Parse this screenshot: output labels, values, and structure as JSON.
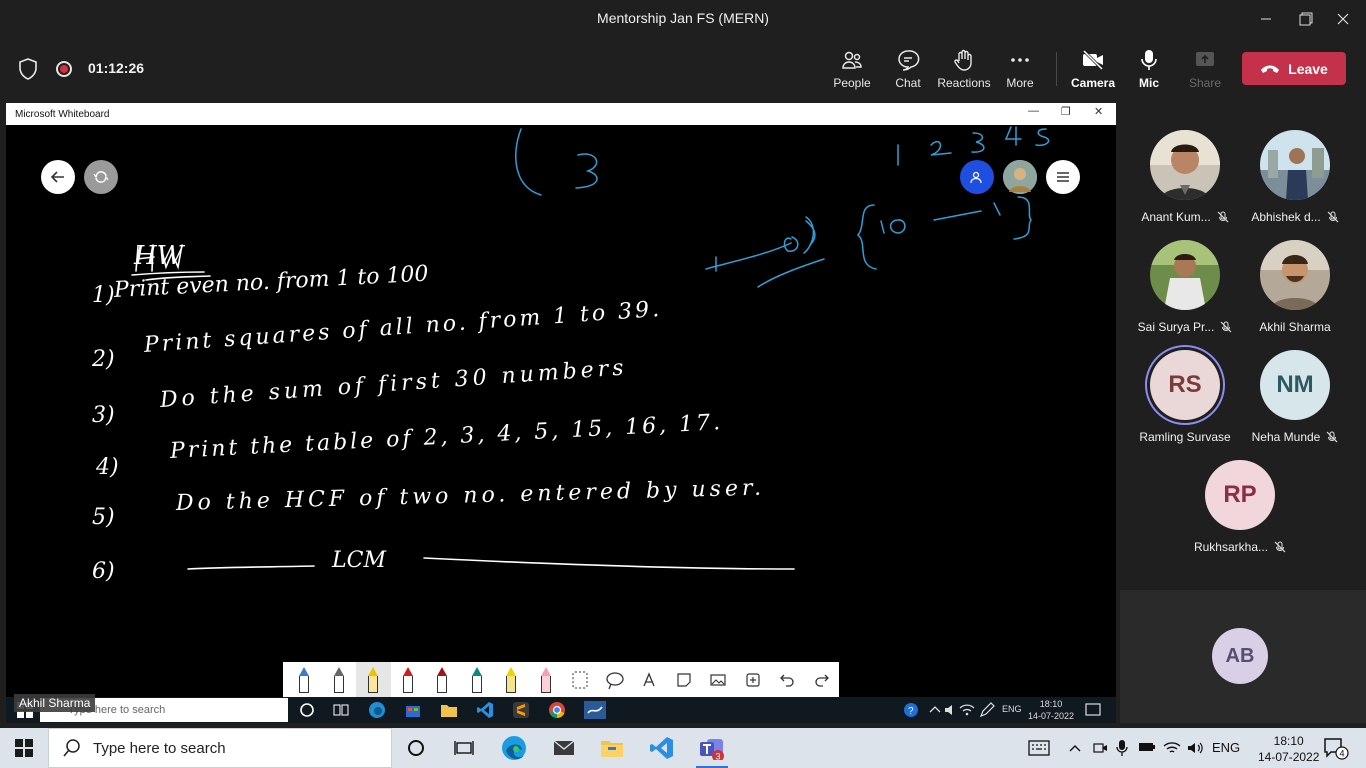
{
  "window": {
    "title": "Mentorship Jan FS (MERN)",
    "controls": [
      "minimize",
      "restore",
      "close"
    ]
  },
  "meeting": {
    "timer": "01:12:26",
    "buttons": [
      {
        "label": "People",
        "icon": "people-icon"
      },
      {
        "label": "Chat",
        "icon": "chat-icon"
      },
      {
        "label": "Reactions",
        "icon": "reactions-icon"
      },
      {
        "label": "More",
        "icon": "more-icon"
      },
      {
        "label": "Camera",
        "icon": "camera-off-icon"
      },
      {
        "label": "Mic",
        "icon": "mic-icon"
      },
      {
        "label": "Share",
        "icon": "share-icon"
      }
    ],
    "leave_label": "Leave",
    "colors": {
      "leave": "#c4314b",
      "background": "#1f1f1f"
    }
  },
  "shared_window": {
    "app_title": "Microsoft Whiteboard",
    "presenter_name": "Akhil Sharma",
    "whiteboard": {
      "heading": "HW",
      "tasks": [
        {
          "num": "1)",
          "text": "Print even no. from 1 to 100"
        },
        {
          "num": "2)",
          "text": "Print squares of all no. from 1 to 39."
        },
        {
          "num": "3)",
          "text": "Do the sum of first 30 numbers"
        },
        {
          "num": "4)",
          "text": "Print the table of 2, 3, 4, 5, 15, 16, 17."
        },
        {
          "num": "5)",
          "text": "Do the HCF of two no. entered by user."
        },
        {
          "num": "6)",
          "text": "LCM"
        }
      ],
      "blue_scribbles": [
        "1",
        "2",
        "3",
        "4",
        "5",
        "{10",
        "1",
        "0"
      ]
    },
    "inner_taskbar": {
      "search_placeholder": "Type here to search",
      "language": "ENG",
      "time": "18:10",
      "date": "14-07-2022"
    }
  },
  "participants": [
    {
      "name": "Anant Kum...",
      "muted": true,
      "type": "photo"
    },
    {
      "name": "Abhishek d...",
      "muted": true,
      "type": "photo"
    },
    {
      "name": "Sai Surya Pr...",
      "muted": true,
      "type": "photo"
    },
    {
      "name": "Akhil Sharma",
      "muted": false,
      "type": "photo"
    },
    {
      "name": "Ramling Survase",
      "muted": false,
      "type": "initials",
      "initials": "RS",
      "speaking": true,
      "bg": "#ead8d8",
      "fg": "#7a3b3b"
    },
    {
      "name": "Neha Munde",
      "muted": true,
      "type": "initials",
      "initials": "NM",
      "bg": "#d6e6ea",
      "fg": "#2d5962"
    },
    {
      "name": "Rukhsarkha...",
      "muted": true,
      "type": "initials",
      "initials": "RP",
      "bg": "#f1d6dc",
      "fg": "#8a2f42"
    }
  ],
  "self_view": {
    "initials": "AB"
  },
  "taskbar": {
    "search_placeholder": "Type here to search",
    "language": "ENG",
    "time": "18:10",
    "date": "14-07-2022",
    "notifications": "4",
    "teams_badge": "3"
  }
}
